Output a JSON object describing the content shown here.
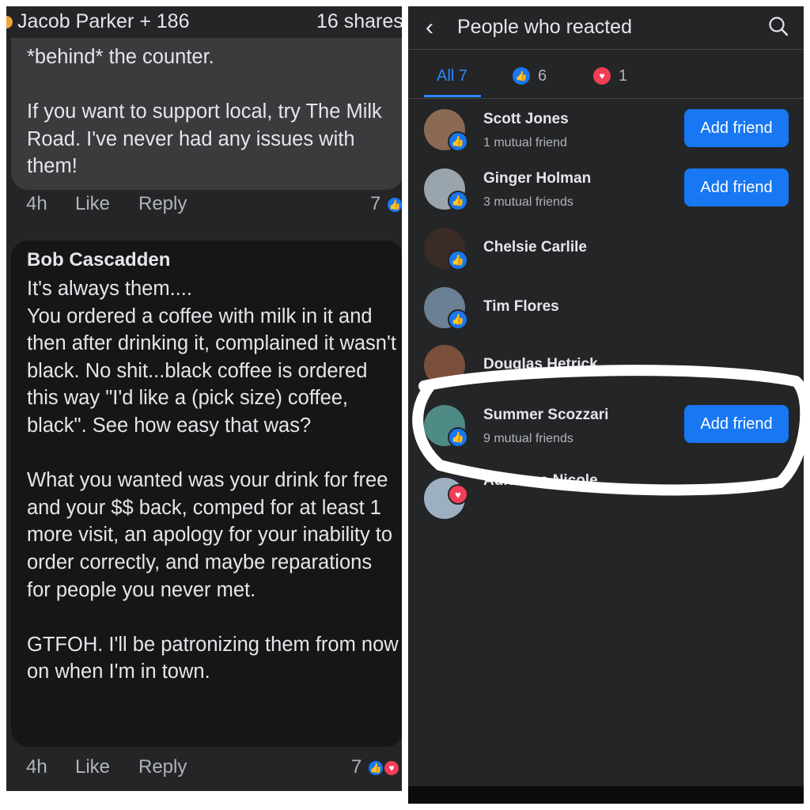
{
  "left_panel": {
    "header": {
      "title": "Jacob Parker + 186",
      "shares": "16 shares"
    },
    "comment1": {
      "text": "*behind* the counter.\n\nIf you want to support local, try The Milk Road. I've never had any issues with them!",
      "time": "4h",
      "like": "Like",
      "reply": "Reply",
      "reaction_count": "7"
    },
    "comment2": {
      "author": "Bob Cascadden",
      "text": "It's always them....\nYou ordered a coffee with milk in it and then after drinking it, complained it wasn't black. No shit...black coffee is ordered this way \"I'd like a (pick size) coffee, black\". See how easy that was?\n\nWhat you wanted was your drink for free and your $$ back, comped for at least 1 more visit, an apology for your inability to order correctly, and maybe reparations for people you never met.\n\nGTFOH. I'll be patronizing them from now on when I'm in town.",
      "time": "4h",
      "like": "Like",
      "reply": "Reply",
      "reaction_count": "7"
    }
  },
  "right_panel": {
    "title": "People who reacted",
    "tabs": [
      {
        "label": "All 7"
      },
      {
        "icon": "like-icon",
        "count": "6"
      },
      {
        "icon": "love-icon",
        "count": "1"
      }
    ],
    "people": [
      {
        "name": "Scott Jones",
        "mutual": "1 mutual friend",
        "reaction": "like",
        "button": "Add friend",
        "avatar_color": "#8a6a55"
      },
      {
        "name": "Ginger Holman",
        "mutual": "3 mutual friends",
        "reaction": "like",
        "button": "Add friend",
        "avatar_color": "#9aa4ad"
      },
      {
        "name": "Chelsie Carlile",
        "mutual": "",
        "reaction": "like",
        "button": "",
        "avatar_color": "#3a2b26"
      },
      {
        "name": "Tim Flores",
        "mutual": "",
        "reaction": "like",
        "button": "",
        "avatar_color": "#6b7f95"
      },
      {
        "name": "Douglas Hetrick",
        "mutual": "",
        "reaction": "like",
        "button": "",
        "avatar_color": "#7a4f3c"
      },
      {
        "name": "Summer Scozzari",
        "mutual": "9 mutual friends",
        "reaction": "like",
        "button": "Add friend",
        "avatar_color": "#4e8a86"
      },
      {
        "name": "Adrianna Nicole",
        "mutual": "",
        "reaction": "love",
        "button": "",
        "avatar_color": "#9db0c2"
      }
    ]
  },
  "colors": {
    "accent_blue": "#1877f2",
    "love_red": "#f33e58",
    "panel_bg": "#242526",
    "bubble_bg": "#3a3b3c"
  }
}
